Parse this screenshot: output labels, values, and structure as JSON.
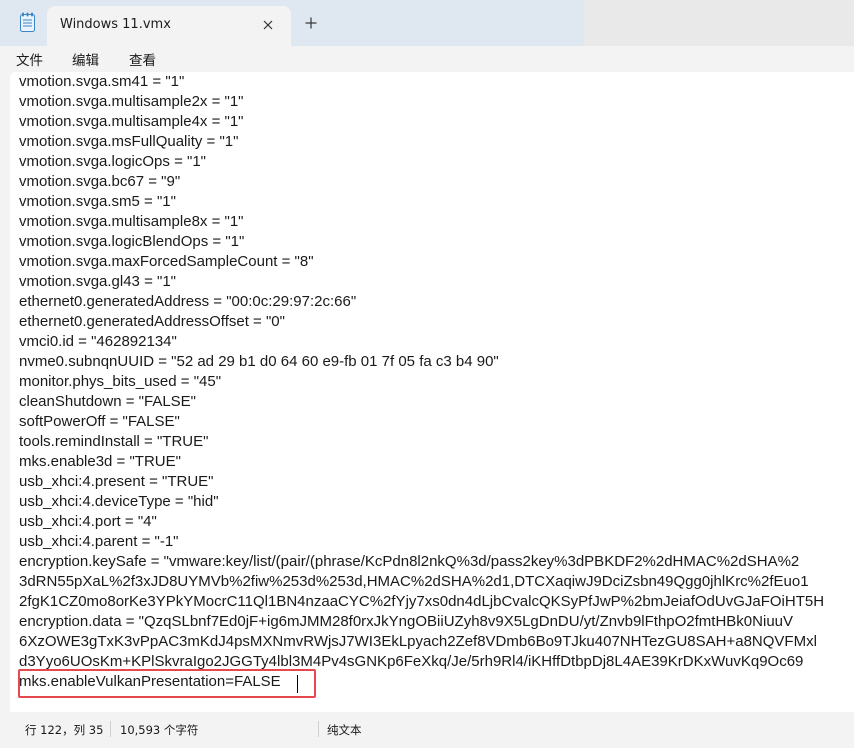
{
  "window": {
    "tab_title": "Windows 11.vmx",
    "new_tab_glyph": "+",
    "close_glyph": "✕"
  },
  "menu": {
    "items": [
      "文件",
      "编辑",
      "查看"
    ]
  },
  "editor": {
    "lines": [
      "vmotion.svga.sm41 = \"1\"",
      "vmotion.svga.multisample2x = \"1\"",
      "vmotion.svga.multisample4x = \"1\"",
      "vmotion.svga.msFullQuality = \"1\"",
      "vmotion.svga.logicOps = \"1\"",
      "vmotion.svga.bc67 = \"9\"",
      "vmotion.svga.sm5 = \"1\"",
      "vmotion.svga.multisample8x = \"1\"",
      "vmotion.svga.logicBlendOps = \"1\"",
      "vmotion.svga.maxForcedSampleCount = \"8\"",
      "vmotion.svga.gl43 = \"1\"",
      "ethernet0.generatedAddress = \"00:0c:29:97:2c:66\"",
      "ethernet0.generatedAddressOffset = \"0\"",
      "vmci0.id = \"462892134\"",
      "nvme0.subnqnUUID = \"52 ad 29 b1 d0 64 60 e9-fb 01 7f 05 fa c3 b4 90\"",
      "monitor.phys_bits_used = \"45\"",
      "cleanShutdown = \"FALSE\"",
      "softPowerOff = \"FALSE\"",
      "tools.remindInstall = \"TRUE\"",
      "mks.enable3d = \"TRUE\"",
      "usb_xhci:4.present = \"TRUE\"",
      "usb_xhci:4.deviceType = \"hid\"",
      "usb_xhci:4.port = \"4\"",
      "usb_xhci:4.parent = \"-1\"",
      "encryption.keySafe = \"vmware:key/list/(pair/(phrase/KcPdn8l2nkQ%3d/pass2key%3dPBKDF2%2dHMAC%2dSHA%2",
      "3dRN55pXaL%2f3xJD8UYMVb%2fiw%253d%253d,HMAC%2dSHA%2d1,DTCXaqiwJ9DciZsbn49Qgg0jhlKrc%2fEuo1",
      "2fgK1CZ0mo8orKe3YPkYMocrC11Ql1BN4nzaaCYC%2fYjy7xs0dn4dLjbCvalcQKSyPfJwP%2bmJeiafOdUvGJaFOiHT5H",
      "encryption.data = \"QzqSLbnf7Ed0jF+ig6mJMM28f0rxJkYngOBiiUZyh8v9X5LgDnDU/yt/Znvb9lFthpO2fmtHBk0NiuuV",
      "6XzOWE3gTxK3vPpAC3mKdJ4psMXNmvRWjsJ7WI3EkLpyach2Zef8VDmb6Bo9TJku407NHTezGU8SAH+a8NQVFMxl",
      "d3Yyo6UOsKm+KPlSkvraIgo2JGGTy4lbl3M4Pv4sGNKp6FeXkq/Je/5rh9Rl4/iKHffDtbpDj8L4AE39KrDKxWuvKq9Oc69",
      "mks.enableVulkanPresentation=FALSE"
    ]
  },
  "status": {
    "position": "行 122，列 35",
    "char_count": "10,593 个字符",
    "encoding_type": "纯文本"
  }
}
